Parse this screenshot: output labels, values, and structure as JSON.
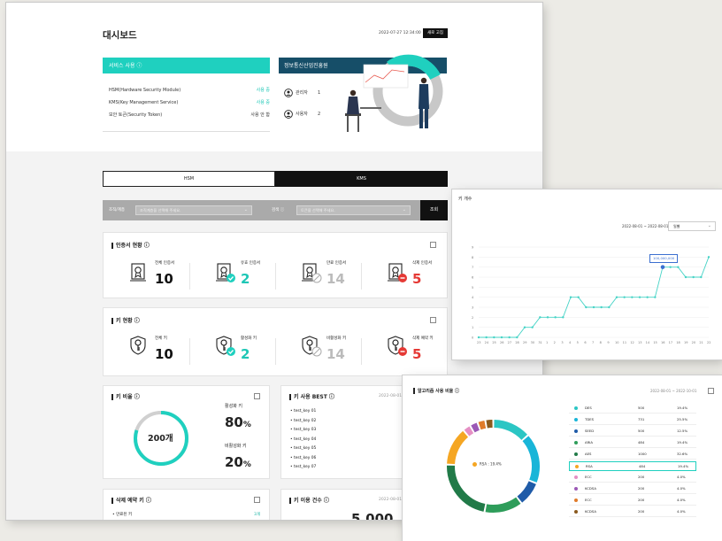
{
  "dashboard": {
    "title": "대시보드",
    "datetime": "2022-07-27 12:34:00",
    "refresh_button": "새로 고침",
    "service_title": "서비스 사용 ⓘ",
    "services": [
      {
        "name": "HSM(Hardware Security Module)",
        "status": "사용 중",
        "color": "#1ec7b6"
      },
      {
        "name": "KMS(Key Management Service)",
        "status": "사용 중",
        "color": "#1ec7b6"
      },
      {
        "name": "보안 토큰(Security Token)",
        "status": "사용 안 함",
        "color": "#333333"
      }
    ],
    "org_title": "정보통신산업진흥원",
    "admin_label": "관리자",
    "admin_count": "1",
    "user_label": "사용자",
    "user_count": "2"
  },
  "tabs": {
    "hsm": "HSM",
    "kms": "KMS",
    "active": "KMS"
  },
  "filter": {
    "org_label": "조직/계층",
    "org_placeholder": "조직계층을 선택해 주세요.",
    "search_label": "검색 ⓘ",
    "search_placeholder": "토큰을 선택해 주세요.",
    "search_button": "조회"
  },
  "cert_status": {
    "title": "인증서 현황 ⓘ",
    "items": [
      {
        "label": "전체 인증서",
        "value": "10",
        "color": "#111111",
        "badge": "none"
      },
      {
        "label": "유효 인증서",
        "value": "2",
        "color": "#1ec7b6",
        "badge": "check"
      },
      {
        "label": "만료 인증서",
        "value": "14",
        "color": "#bbbbbb",
        "badge": "slash"
      },
      {
        "label": "삭제 인증서",
        "value": "5",
        "color": "#e53935",
        "badge": "minus"
      }
    ]
  },
  "key_status": {
    "title": "키 현황 ⓘ",
    "items": [
      {
        "label": "전체 키",
        "value": "10",
        "color": "#111111",
        "badge": "none"
      },
      {
        "label": "활성화 키",
        "value": "2",
        "color": "#1ec7b6",
        "badge": "check"
      },
      {
        "label": "비활성화 키",
        "value": "14",
        "color": "#bbbbbb",
        "badge": "slash"
      },
      {
        "label": "삭제 예약 키",
        "value": "5",
        "color": "#e53935",
        "badge": "minus"
      }
    ]
  },
  "key_ratio": {
    "title": "키 비율 ⓘ",
    "center": "200개",
    "active_label": "활성화 키",
    "active_value": "80",
    "inactive_label": "비활성화 키",
    "inactive_value": "20",
    "unit": "%",
    "active_fraction": 0.8
  },
  "key_best": {
    "title": "키 사용 BEST ⓘ",
    "date": "2022-08-01",
    "items": [
      "test_key 01",
      "test_key 02",
      "test_key 03",
      "test_key 04",
      "test_key 05",
      "test_key 06",
      "test_key 07"
    ]
  },
  "delete_key": {
    "title": "삭제 예약 키 ⓘ",
    "row_label": "만료된 키",
    "row_value": "3개"
  },
  "key_usage": {
    "title": "키 이용 건수 ⓘ",
    "date": "2022-08-01",
    "value": "5,000"
  },
  "line_panel": {
    "title": "키 개수",
    "date_range": "2022-08-01 ~ 2022-08-01",
    "period": "일별",
    "tooltip": "100,000,000"
  },
  "algo_panel": {
    "title": "알고리즘 사용 비율 ⓘ",
    "date_range": "2022-08-01 ~ 2022-10-01",
    "donut_label": "RSA : 19.4%"
  },
  "chart_data": [
    {
      "type": "line",
      "title": "키 개수",
      "x": [
        "23",
        "24",
        "25",
        "26",
        "27",
        "28",
        "29",
        "30",
        "31",
        "1",
        "2",
        "3",
        "4",
        "5",
        "6",
        "7",
        "8",
        "9",
        "10",
        "11",
        "12",
        "13",
        "14",
        "15",
        "16",
        "17",
        "18",
        "19",
        "20",
        "21",
        "22"
      ],
      "series": [
        {
          "values": [
            0,
            0,
            0,
            0,
            0,
            0,
            1,
            1,
            2,
            2,
            2,
            2,
            4,
            4,
            3,
            3,
            3,
            3,
            4,
            4,
            4,
            4,
            4,
            4,
            7,
            7,
            7,
            6,
            6,
            6,
            8
          ]
        }
      ],
      "ylim": [
        0,
        9
      ],
      "yticks": [
        "0",
        "1",
        "2",
        "3",
        "4",
        "5",
        "6",
        "7",
        "8",
        "9"
      ],
      "annotation": {
        "x": "16",
        "label": "100,000,000"
      },
      "grid": true,
      "color": "#46d3c6"
    },
    {
      "type": "pie",
      "title": "알고리즘 사용 비율",
      "rows": [
        {
          "name": "DES",
          "value": "500",
          "pct": "19.4%",
          "num": 19.4,
          "color": "#2bc6c4"
        },
        {
          "name": "TDES",
          "value": "731",
          "pct": "25.5%",
          "num": 25.5,
          "color": "#19b5d8"
        },
        {
          "name": "SEED",
          "value": "500",
          "pct": "12.5%",
          "num": 12.5,
          "color": "#1f5ba8"
        },
        {
          "name": "ARIA",
          "value": "484",
          "pct": "19.4%",
          "num": 19.4,
          "color": "#2e9d5a"
        },
        {
          "name": "AES",
          "value": "1000",
          "pct": "32.6%",
          "num": 32.6,
          "color": "#217a48"
        },
        {
          "name": "RSA",
          "value": "484",
          "pct": "19.4%",
          "num": 19.4,
          "color": "#f5a623"
        },
        {
          "name": "ECC",
          "value": "200",
          "pct": "4.0%",
          "num": 4.0,
          "color": "#e58fc4"
        },
        {
          "name": "KCDSA",
          "value": "200",
          "pct": "4.0%",
          "num": 4.0,
          "color": "#9b59b6"
        },
        {
          "name": "ECC",
          "value": "200",
          "pct": "4.0%",
          "num": 4.0,
          "color": "#e07b2a"
        },
        {
          "name": "KCDSA",
          "value": "200",
          "pct": "4.0%",
          "num": 4.0,
          "color": "#8a5a1e"
        }
      ],
      "highlight": "RSA"
    }
  ]
}
